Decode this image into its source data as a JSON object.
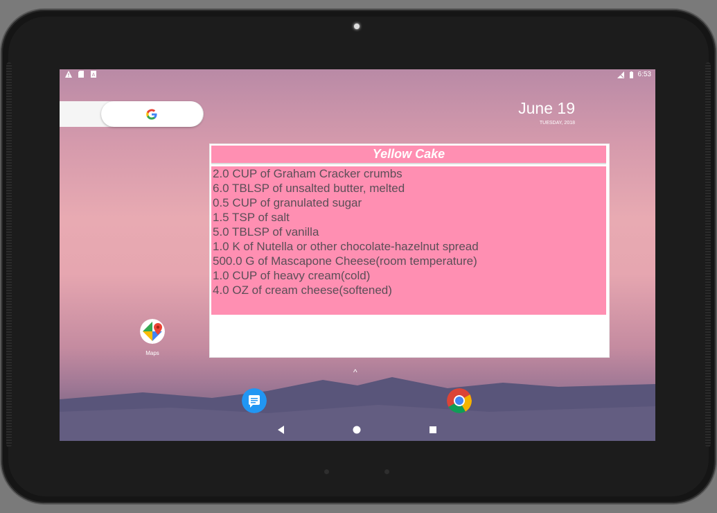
{
  "status_bar": {
    "time": "6:53",
    "left_icons": [
      "warning-icon",
      "sd-card-icon",
      "notification-a-icon"
    ],
    "right_icons": [
      "signal-off-icon",
      "battery-icon"
    ]
  },
  "search_widget": {
    "icon": "google-g-icon"
  },
  "clock_widget": {
    "date": "June 19",
    "day": "TUESDAY, 2018"
  },
  "recipe_widget": {
    "title": "Yellow Cake",
    "ingredients": [
      "2.0 CUP of Graham Cracker crumbs",
      "6.0 TBLSP of unsalted butter, melted",
      "0.5 CUP of granulated sugar",
      "1.5 TSP of salt",
      "5.0 TBLSP of vanilla",
      "1.0 K of Nutella or other chocolate-hazelnut spread",
      "500.0 G of Mascapone Cheese(room temperature)",
      "1.0 CUP of heavy cream(cold)",
      "4.0 OZ of cream cheese(softened)"
    ],
    "colors": {
      "header": "#ff8fb2",
      "body": "#ff8fb2",
      "text": "#5b4e57"
    }
  },
  "home_apps": [
    {
      "label": "Maps",
      "icon": "maps-icon"
    }
  ],
  "dock": [
    {
      "icon": "messages-icon"
    },
    {
      "icon": "chrome-icon"
    }
  ],
  "app_drawer_caret": "^",
  "nav": {
    "back": "back-icon",
    "home": "home-icon",
    "recents": "recents-icon"
  }
}
